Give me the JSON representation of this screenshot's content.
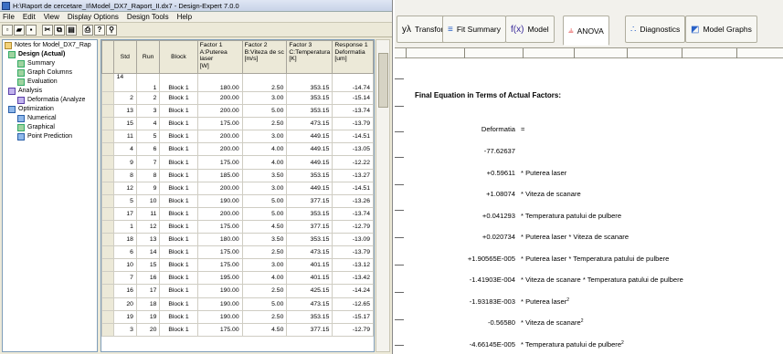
{
  "left_window": {
    "title": "H:\\Raport de cercetare_II\\Model_DX7_Raport_II.dx7 - Design-Expert 7.0.0",
    "menu": [
      "File",
      "Edit",
      "View",
      "Display Options",
      "Design Tools",
      "Help"
    ],
    "tree": [
      {
        "label": "Notes for Model_DX7_Rap",
        "icon": "notes-icon",
        "bold": false
      },
      {
        "label": "Design (Actual)",
        "icon": "design-icon",
        "bold": true
      },
      {
        "label": "Summary",
        "icon": "summary-icon",
        "bold": false
      },
      {
        "label": "Graph Columns",
        "icon": "graph-columns-icon",
        "bold": false
      },
      {
        "label": "Evaluation",
        "icon": "evaluation-icon",
        "bold": false
      },
      {
        "label": "Analysis",
        "icon": "analysis-icon",
        "bold": false
      },
      {
        "label": "Deformatia (Analyze",
        "icon": "response-icon",
        "bold": false
      },
      {
        "label": "Optimization",
        "icon": "optimization-icon",
        "bold": false
      },
      {
        "label": "Numerical",
        "icon": "numerical-icon",
        "bold": false
      },
      {
        "label": "Graphical",
        "icon": "graphical-icon",
        "bold": false
      },
      {
        "label": "Point Prediction",
        "icon": "point-prediction-icon",
        "bold": false
      }
    ],
    "grid": {
      "headers": [
        "Std",
        "Run",
        "Block",
        "Factor 1\nA:Puterea laser\n[W]",
        "Factor 2\nB:Viteza de sc\n[m/s]",
        "Factor 3\nC:Temperatura\n[K]",
        "Response 1\nDeformatia\n[um]"
      ],
      "rows": [
        [
          "14",
          "",
          "",
          "",
          "",
          "",
          ""
        ],
        [
          "2",
          "2",
          "Block 1",
          "200.00",
          "3.00",
          "353.15",
          "-15.14"
        ],
        [
          "13",
          "3",
          "Block 1",
          "200.00",
          "5.00",
          "353.15",
          "-13.74"
        ],
        [
          "15",
          "4",
          "Block 1",
          "175.00",
          "2.50",
          "473.15",
          "-13.79"
        ],
        [
          "11",
          "5",
          "Block 1",
          "200.00",
          "3.00",
          "449.15",
          "-14.51"
        ],
        [
          "4",
          "6",
          "Block 1",
          "200.00",
          "4.00",
          "449.15",
          "-13.05"
        ],
        [
          "9",
          "7",
          "Block 1",
          "175.00",
          "4.00",
          "449.15",
          "-12.22"
        ],
        [
          "8",
          "8",
          "Block 1",
          "185.00",
          "3.50",
          "353.15",
          "-13.27"
        ],
        [
          "12",
          "9",
          "Block 1",
          "200.00",
          "3.00",
          "449.15",
          "-14.51"
        ],
        [
          "5",
          "10",
          "Block 1",
          "190.00",
          "5.00",
          "377.15",
          "-13.26"
        ],
        [
          "17",
          "11",
          "Block 1",
          "200.00",
          "5.00",
          "353.15",
          "-13.74"
        ],
        [
          "1",
          "12",
          "Block 1",
          "175.00",
          "4.50",
          "377.15",
          "-12.79"
        ],
        [
          "18",
          "13",
          "Block 1",
          "180.00",
          "3.50",
          "353.15",
          "-13.09"
        ],
        [
          "6",
          "14",
          "Block 1",
          "175.00",
          "2.50",
          "473.15",
          "-13.79"
        ],
        [
          "10",
          "15",
          "Block 1",
          "175.00",
          "3.00",
          "401.15",
          "-13.12"
        ],
        [
          "7",
          "16",
          "Block 1",
          "195.00",
          "4.00",
          "401.15",
          "-13.42"
        ],
        [
          "16",
          "17",
          "Block 1",
          "190.00",
          "2.50",
          "425.15",
          "-14.24"
        ],
        [
          "20",
          "18",
          "Block 1",
          "190.00",
          "5.00",
          "473.15",
          "-12.65"
        ],
        [
          "19",
          "19",
          "Block 1",
          "190.00",
          "2.50",
          "353.15",
          "-15.17"
        ],
        [
          "3",
          "20",
          "Block 1",
          "175.00",
          "4.50",
          "377.15",
          "-12.79"
        ]
      ],
      "first_row_extra": [
        "",
        "1",
        "Block 1",
        "180.00",
        "2.50",
        "353.15",
        "-14.74"
      ]
    }
  },
  "right_window": {
    "tabs": [
      {
        "label": "Transform",
        "icon": "transform-icon",
        "glyph": "yλ"
      },
      {
        "label": "Fit Summary",
        "icon": "fit-summary-icon",
        "glyph": "≡"
      },
      {
        "label": "Model",
        "icon": "model-icon",
        "glyph": "f(x)"
      },
      {
        "label": "ANOVA",
        "icon": "anova-icon",
        "glyph": "⫨"
      },
      {
        "label": "Diagnostics",
        "icon": "diagnostics-icon",
        "glyph": "∴"
      },
      {
        "label": "Model Graphs",
        "icon": "model-graphs-icon",
        "glyph": "◩"
      }
    ],
    "active_tab": "ANOVA",
    "report_title": "Final Equation in Terms of Actual Factors:",
    "response_label": "Deformatia",
    "equals": "=",
    "terms": [
      {
        "coef": "-77.62637",
        "term": "",
        "sup": ""
      },
      {
        "coef": "+0.59611",
        "term": "* Puterea laser",
        "sup": ""
      },
      {
        "coef": "+1.08074",
        "term": "* Viteza de scanare",
        "sup": ""
      },
      {
        "coef": "+0.041293",
        "term": "* Temperatura patului de pulbere",
        "sup": ""
      },
      {
        "coef": "+0.020734",
        "term": "* Puterea laser * Viteza de scanare",
        "sup": ""
      },
      {
        "coef": "+1.90565E-005",
        "term": "* Puterea laser * Temperatura patului de pulbere",
        "sup": ""
      },
      {
        "coef": "-1.41903E-004",
        "term": "* Viteza de scanare * Temperatura patului de pulbere",
        "sup": ""
      },
      {
        "coef": "-1.93183E-003",
        "term": "* Puterea laser",
        "sup": "2"
      },
      {
        "coef": "-0.56580",
        "term": "* Viteza de scanare",
        "sup": "2"
      },
      {
        "coef": "-4.66145E-005",
        "term": "* Temperatura patului de pulbere",
        "sup": "2"
      }
    ]
  }
}
